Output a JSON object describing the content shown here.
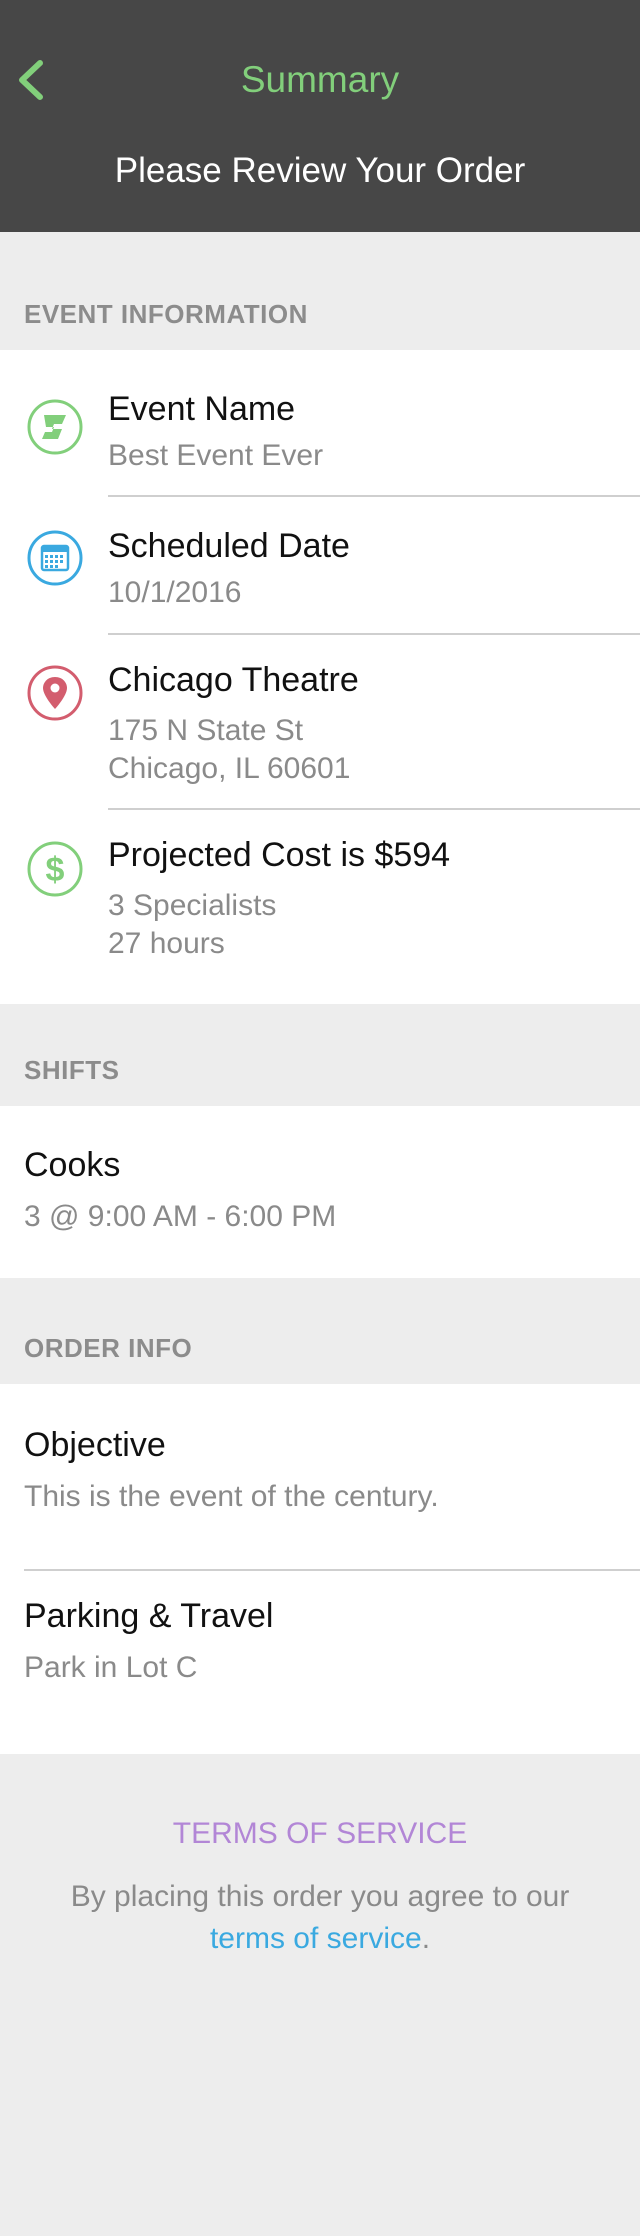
{
  "header": {
    "title": "Summary",
    "subtitle": "Please Review Your Order"
  },
  "colors": {
    "header_bg": "#474747",
    "accent_green": "#82cf7b",
    "icon_blue": "#3aa9e0",
    "icon_red": "#d35d6e",
    "link_blue": "#3aa9e0",
    "tos_purple": "#b286d6"
  },
  "event_information": {
    "label": "EVENT INFORMATION",
    "rows": [
      {
        "icon": "event-logo-icon",
        "title": "Event Name",
        "lines": [
          "Best Event Ever"
        ]
      },
      {
        "icon": "calendar-icon",
        "title": "Scheduled Date",
        "lines": [
          "10/1/2016"
        ]
      },
      {
        "icon": "location-pin-icon",
        "title": "Chicago Theatre",
        "lines": [
          "175 N State St",
          "Chicago, IL 60601"
        ]
      },
      {
        "icon": "dollar-icon",
        "title": "Projected Cost is $594",
        "lines": [
          "3 Specialists",
          "27 hours"
        ]
      }
    ]
  },
  "shifts": {
    "label": "SHIFTS",
    "items": [
      {
        "title": "Cooks",
        "detail": "3 @ 9:00 AM - 6:00 PM"
      }
    ]
  },
  "order_info": {
    "label": "ORDER INFO",
    "items": [
      {
        "title": "Objective",
        "detail": "This is the event of the century."
      },
      {
        "title": "Parking & Travel",
        "detail": "Park in Lot C"
      }
    ]
  },
  "terms": {
    "title": "TERMS OF SERVICE",
    "text_before": "By placing this order you agree to our ",
    "link_text": "terms of service",
    "text_after": "."
  }
}
